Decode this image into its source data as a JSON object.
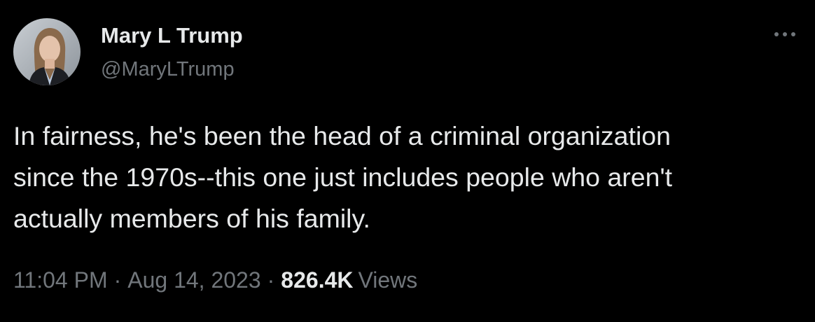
{
  "author": {
    "display_name": "Mary L Trump",
    "handle": "@MaryLTrump"
  },
  "tweet": {
    "text": "In fairness, he's been the head of a criminal organization\nsince the 1970s--this one just includes people who aren't\nactually members of his family."
  },
  "meta": {
    "time": "11:04 PM",
    "separator": "·",
    "date": "Aug 14, 2023",
    "views_count": "826.4K",
    "views_label": "Views"
  },
  "icons": {
    "more": "more-horizontal-icon",
    "avatar": "profile-photo"
  },
  "colors": {
    "background": "#000000",
    "primary_text": "#e7e9ea",
    "secondary_text": "#71767b"
  }
}
